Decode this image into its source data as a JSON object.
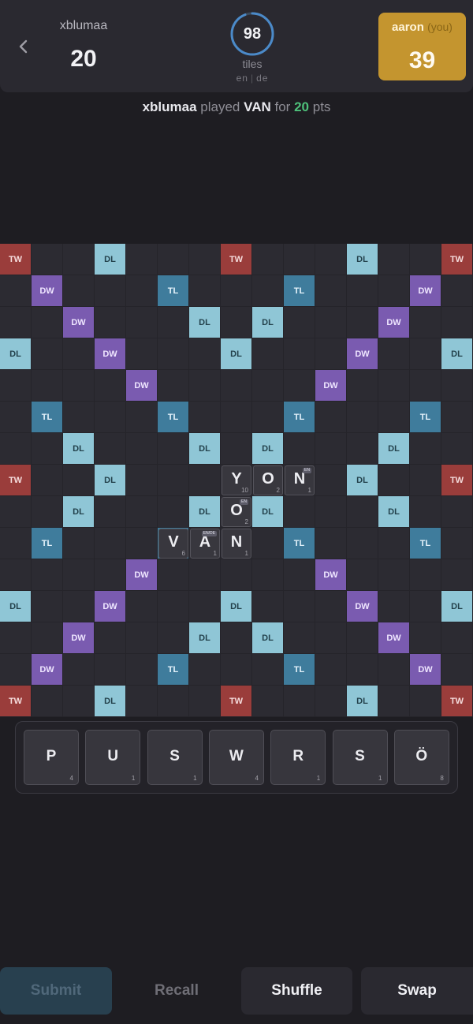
{
  "header": {
    "opponent": {
      "name": "xblumaa",
      "score": "20"
    },
    "tiles_remaining": "98",
    "tiles_label": "tiles",
    "languages": [
      "en",
      "de"
    ],
    "me": {
      "name": "aaron",
      "you_label": "(you)",
      "score": "39"
    }
  },
  "last_move": {
    "player": "xblumaa",
    "verb": "played",
    "word": "VAN",
    "for_text": "for",
    "points": "20",
    "pts_label": "pts"
  },
  "board": {
    "size": 15,
    "premium_labels": {
      "TW": "TW",
      "DW": "DW",
      "TL": "TL",
      "DL": "DL"
    },
    "rows": [
      "TW . . DL . . . TW . . . DL . . TW",
      ". DW . . . TL . . . TL . . . DW .",
      ". . DW . . . DL . DL . . . DW . .",
      "DL . . DW . . . DL . . . DW . . DL",
      ". . . . DW . . . . . DW . . . .",
      ". TL . . . TL . . . TL . . . TL .",
      ". . DL . . . DL . DL . . . DL . .",
      "TW . . DL . . . ST . . . DL . . TW",
      ". . DL . . . DL . DL . . . DL . .",
      ". TL . . . TL . . . TL . . . TL .",
      ". . . . DW . . . . . DW . . . .",
      "DL . . DW . . . DL . . . DW . . DL",
      ". . DW . . . DL . DL . . . DW . .",
      ". DW . . . TL . . . TL . . . DW .",
      "TW . . DL . . . TW . . . DL . . TW"
    ],
    "tiles": [
      {
        "row": 7,
        "col": 7,
        "letter": "Y",
        "value": "10"
      },
      {
        "row": 7,
        "col": 8,
        "letter": "O",
        "value": "2"
      },
      {
        "row": 7,
        "col": 9,
        "letter": "N",
        "value": "1",
        "tag": "EN"
      },
      {
        "row": 8,
        "col": 7,
        "letter": "O",
        "value": "2",
        "tag": "EN"
      },
      {
        "row": 9,
        "col": 5,
        "letter": "V",
        "value": "6"
      },
      {
        "row": 9,
        "col": 6,
        "letter": "A",
        "value": "1",
        "tag": "EN/DE"
      },
      {
        "row": 9,
        "col": 7,
        "letter": "N",
        "value": "1"
      }
    ]
  },
  "rack": [
    {
      "letter": "P",
      "value": "4"
    },
    {
      "letter": "U",
      "value": "1"
    },
    {
      "letter": "S",
      "value": "1"
    },
    {
      "letter": "W",
      "value": "4"
    },
    {
      "letter": "R",
      "value": "1"
    },
    {
      "letter": "S",
      "value": "1"
    },
    {
      "letter": "Ö",
      "value": "8"
    }
  ],
  "actions": {
    "submit": "Submit",
    "recall": "Recall",
    "shuffle": "Shuffle",
    "swap": "Swap"
  },
  "colors": {
    "tw": "#9a3d3b",
    "dw": "#7a5bb0",
    "tl": "#3f7c9c",
    "dl": "#8fc6d6",
    "me_accent": "#c4952f",
    "points": "#4ec07a"
  }
}
